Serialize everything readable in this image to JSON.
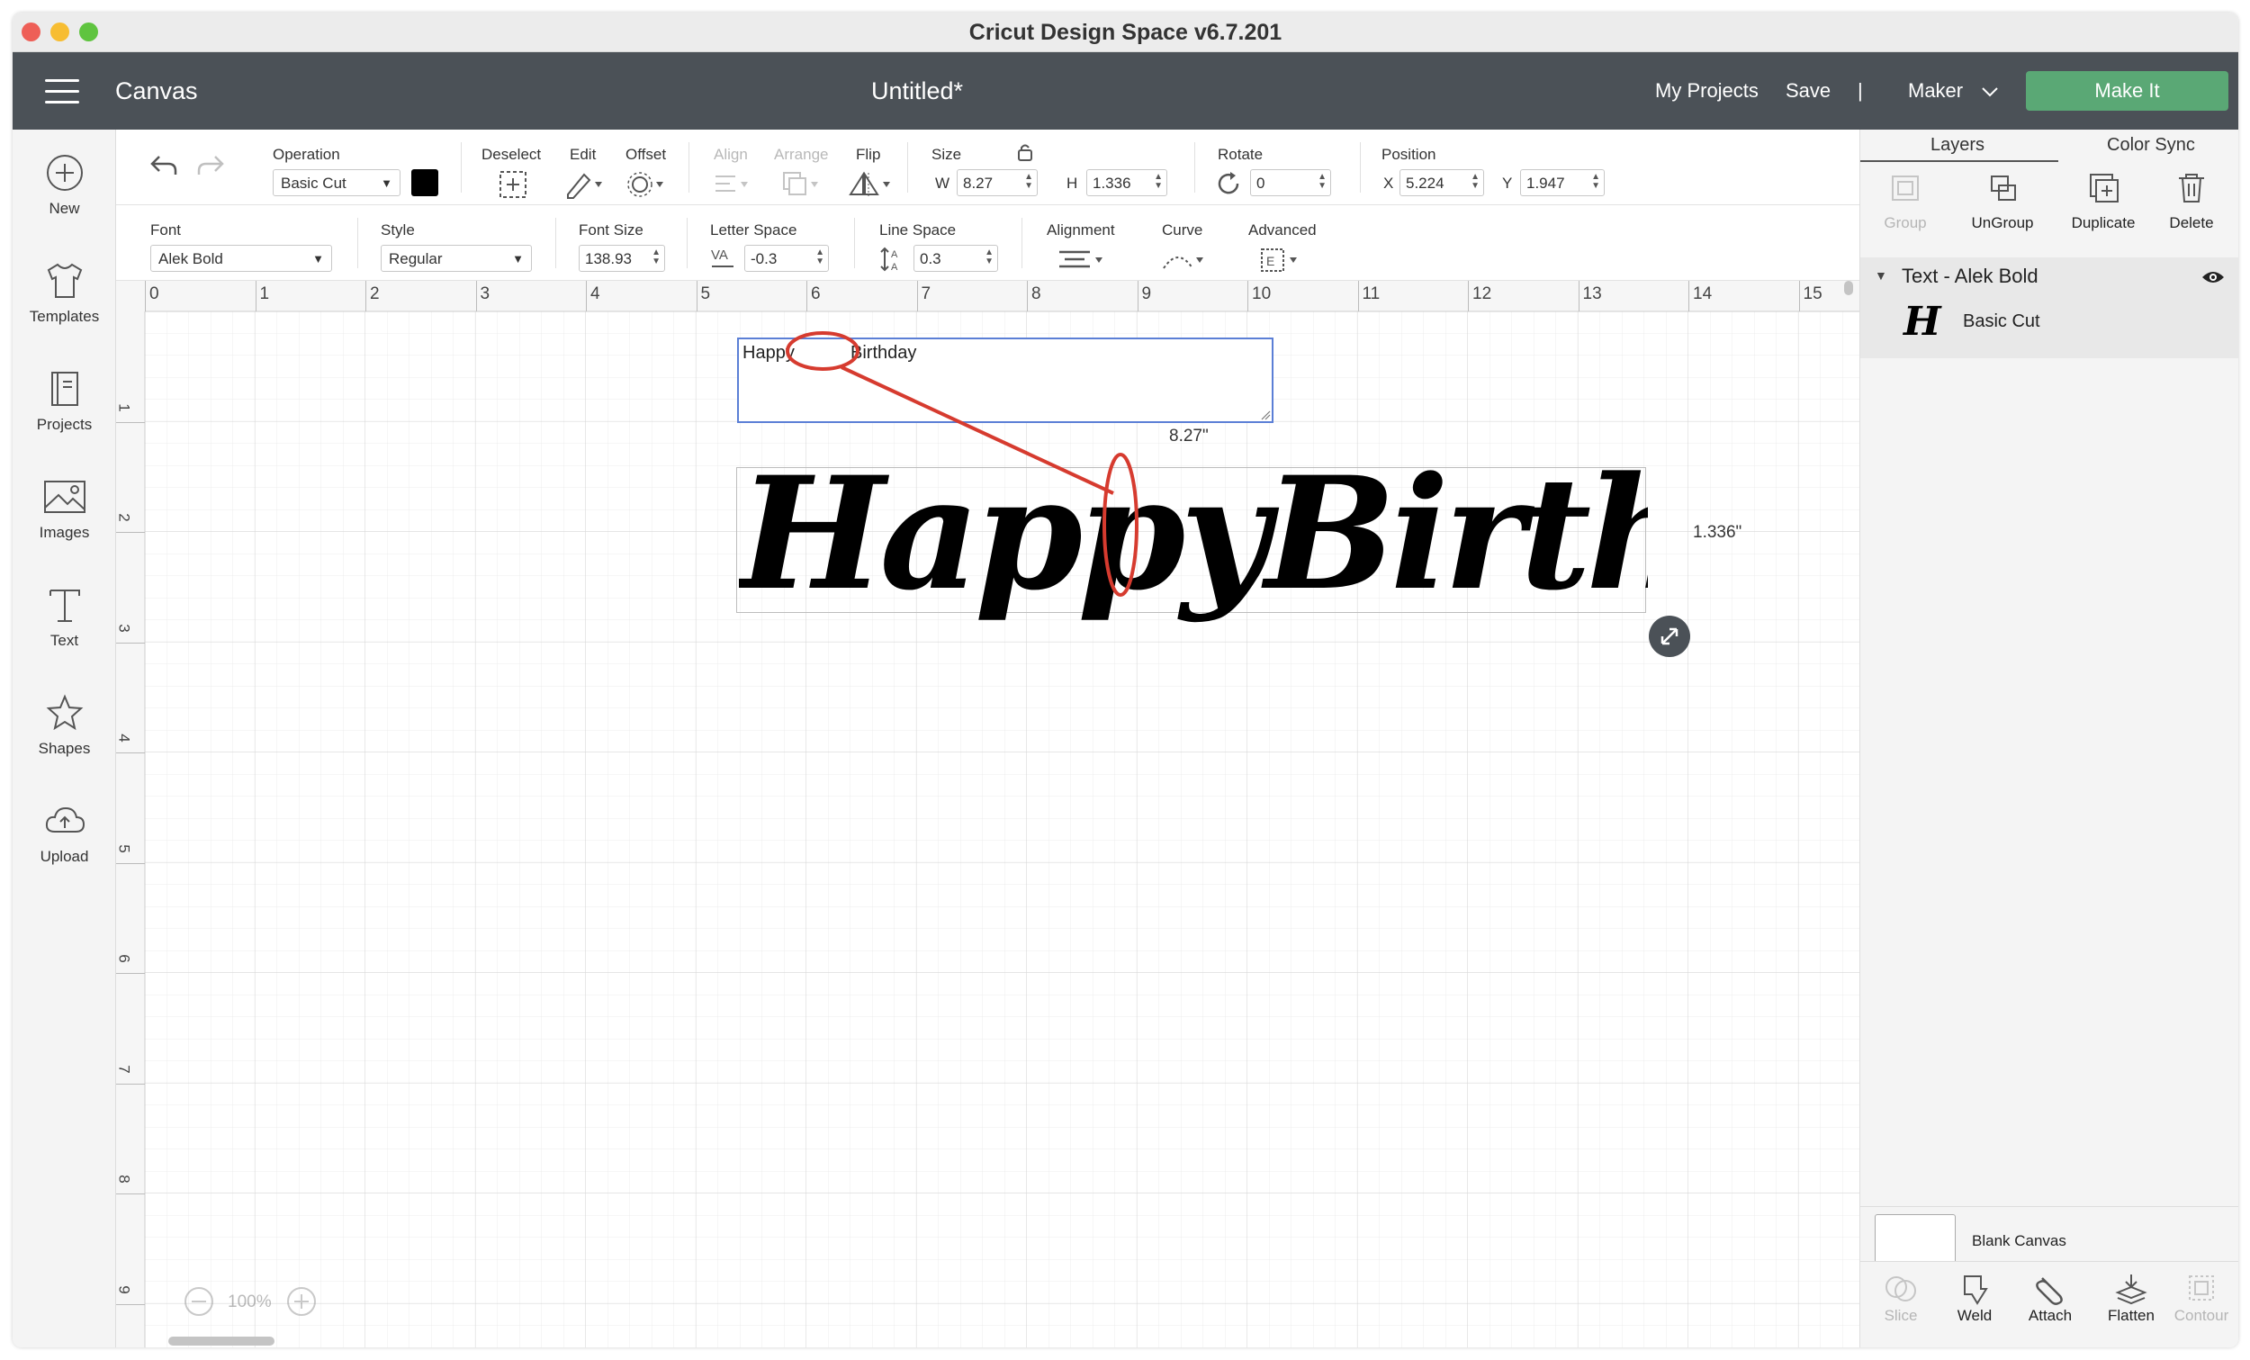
{
  "window": {
    "title": "Cricut Design Space  v6.7.201"
  },
  "appbar": {
    "canvas_label": "Canvas",
    "doc_title": "Untitled*",
    "my_projects": "My Projects",
    "save": "Save",
    "divider": "|",
    "machine": "Maker",
    "make_it": "Make It"
  },
  "leftbar": {
    "items": [
      {
        "label": "New",
        "icon": "plus-circle-icon"
      },
      {
        "label": "Templates",
        "icon": "tshirt-icon"
      },
      {
        "label": "Projects",
        "icon": "book-icon"
      },
      {
        "label": "Images",
        "icon": "image-icon"
      },
      {
        "label": "Text",
        "icon": "text-icon"
      },
      {
        "label": "Shapes",
        "icon": "shapes-icon"
      },
      {
        "label": "Upload",
        "icon": "cloud-upload-icon"
      }
    ]
  },
  "toolbar1": {
    "operation_label": "Operation",
    "operation_value": "Basic Cut",
    "deselect": "Deselect",
    "edit": "Edit",
    "offset": "Offset",
    "align": "Align",
    "arrange": "Arrange",
    "flip": "Flip",
    "size_label": "Size",
    "w_label": "W",
    "w_value": "8.27",
    "h_label": "H",
    "h_value": "1.336",
    "rotate_label": "Rotate",
    "rotate_value": "0",
    "position_label": "Position",
    "x_label": "X",
    "x_value": "5.224",
    "y_label": "Y",
    "y_value": "1.947",
    "swatch_color": "#000000"
  },
  "toolbar2": {
    "font_label": "Font",
    "font_value": "Alek Bold",
    "style_label": "Style",
    "style_value": "Regular",
    "font_size_label": "Font Size",
    "font_size_value": "138.93",
    "letter_space_label": "Letter Space",
    "letter_space_value": "-0.3",
    "line_space_label": "Line Space",
    "line_space_value": "0.3",
    "alignment_label": "Alignment",
    "curve_label": "Curve",
    "advanced_label": "Advanced"
  },
  "canvas": {
    "ruler_top": [
      "0",
      "1",
      "2",
      "3",
      "4",
      "5",
      "6",
      "7",
      "8",
      "9",
      "10",
      "11",
      "12",
      "13",
      "14",
      "15"
    ],
    "ruler_left": [
      "1",
      "2",
      "3",
      "4",
      "5",
      "6",
      "7",
      "8",
      "9"
    ],
    "text_box": {
      "word1": "Happy",
      "word2": "Birthday"
    },
    "design_text": "HappyBirthday",
    "width_readout": "8.27\"",
    "height_readout": "1.336\"",
    "zoom": "100%",
    "annotation_color": "#d63b2f"
  },
  "rpanel": {
    "tabs": [
      "Layers",
      "Color Sync"
    ],
    "actions": [
      {
        "label": "Group",
        "icon": "group-icon",
        "enabled": false
      },
      {
        "label": "UnGroup",
        "icon": "ungroup-icon",
        "enabled": true
      },
      {
        "label": "Duplicate",
        "icon": "duplicate-icon",
        "enabled": true
      },
      {
        "label": "Delete",
        "icon": "trash-icon",
        "enabled": true
      }
    ],
    "layer_group_title": "Text - Alek Bold",
    "layer_item_glyph": "H",
    "layer_item_label": "Basic Cut",
    "blank_canvas": "Blank Canvas",
    "bottom_tools": [
      {
        "label": "Slice",
        "icon": "slice-icon",
        "enabled": false
      },
      {
        "label": "Weld",
        "icon": "weld-icon",
        "enabled": true
      },
      {
        "label": "Attach",
        "icon": "paperclip-icon",
        "enabled": true
      },
      {
        "label": "Flatten",
        "icon": "flatten-icon",
        "enabled": true
      },
      {
        "label": "Contour",
        "icon": "contour-icon",
        "enabled": false
      }
    ]
  }
}
